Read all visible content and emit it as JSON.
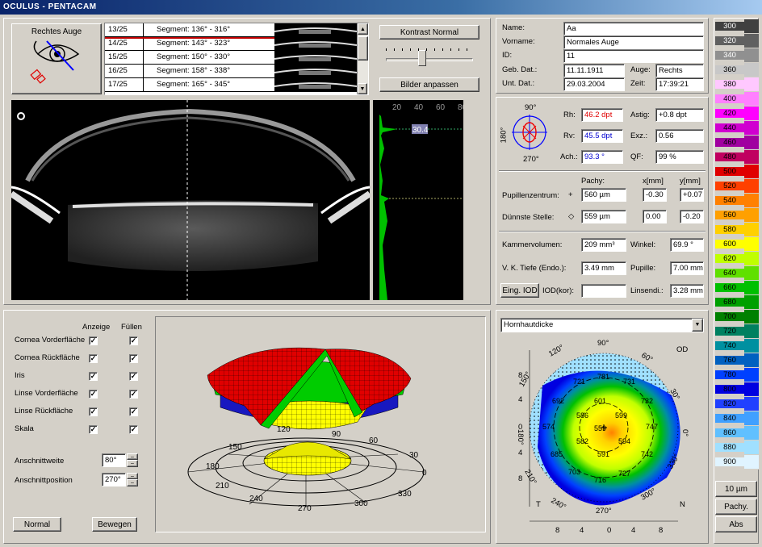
{
  "window_title": "OCULUS - PENTACAM",
  "eye_button": {
    "label": "Rechtes Auge"
  },
  "segments": [
    {
      "index": "13/25",
      "label": "Segment: 136° - 316°"
    },
    {
      "index": "14/25",
      "label": "Segment: 143° - 323°"
    },
    {
      "index": "15/25",
      "label": "Segment: 150° - 330°"
    },
    {
      "index": "16/25",
      "label": "Segment: 158° - 338°"
    },
    {
      "index": "17/25",
      "label": "Segment: 165° - 345°"
    }
  ],
  "buttons": {
    "contrast": "Kontrast Normal",
    "fit_images": "Bilder anpassen",
    "normal": "Normal",
    "move": "Bewegen",
    "eing_iod": "Eing. IOD"
  },
  "density_plot": {
    "ticks": [
      "20",
      "40",
      "60",
      "80"
    ],
    "marker_value": "30.4"
  },
  "patient": {
    "name_label": "Name:",
    "name": "Aa",
    "firstname_label": "Vorname:",
    "firstname": "Normales Auge",
    "id_label": "ID:",
    "id": "11",
    "dob_label": "Geb. Dat.:",
    "dob": "11.11.1911",
    "eye_label": "Auge:",
    "eye": "Rechts",
    "exam_label": "Unt. Dat.:",
    "exam": "29.03.2004",
    "time_label": "Zeit:",
    "time": "17:39:21"
  },
  "kerato": {
    "rh_label": "Rh:",
    "rh": "46.2 dpt",
    "astig_label": "Astig:",
    "astig": "+0.8 dpt",
    "rv_label": "Rv:",
    "rv": "45.5 dpt",
    "exz_label": "Exz.:",
    "exz": "0.56",
    "ach_label": "Ach.:",
    "ach": "93.3 °",
    "qf_label": "QF:",
    "qf": "99 %",
    "deg90": "90°",
    "deg180": "180°",
    "deg270": "270°"
  },
  "pachy": {
    "col_pachy": "Pachy:",
    "col_x": "x[mm]",
    "col_y": "y[mm]",
    "pupil_label": "Pupillenzentrum:",
    "pupil_sym": "+",
    "pupil_pachy": "560 µm",
    "pupil_x": "-0.30",
    "pupil_y": "+0.07",
    "thin_label": "Dünnste Stelle:",
    "thin_sym": "◇",
    "thin_pachy": "559 µm",
    "thin_x": "0.00",
    "thin_y": "-0.20"
  },
  "chamber": {
    "vol_label": "Kammervolumen:",
    "vol": "209 mm³",
    "angle_label": "Winkel:",
    "angle": "69.9 °",
    "depth_label": "V. K. Tiefe (Endo.):",
    "depth": "3.49 mm",
    "pupil_label": "Pupille:",
    "pupil": "7.00 mm",
    "iod_label": "IOD(kor):",
    "iod": "",
    "lens_label": "Linsendi.:",
    "lens": "3.28 mm"
  },
  "display": {
    "col_show": "Anzeige",
    "col_fill": "Füllen",
    "rows": [
      {
        "label": "Cornea Vorderfläche",
        "show": "✓",
        "fill": "✓"
      },
      {
        "label": "Cornea Rückfläche",
        "show": "✓",
        "fill": "✓"
      },
      {
        "label": "Iris",
        "show": "✓",
        "fill": "✓"
      },
      {
        "label": "Linse Vorderfläche",
        "show": "✓",
        "fill": "✓"
      },
      {
        "label": "Linse Rückfläche",
        "show": "✓",
        "fill": "✓"
      },
      {
        "label": "Skala",
        "show": "✓",
        "fill": "✓"
      }
    ],
    "width_label": "Anschnittweite",
    "width": "80°",
    "position_label": "Anschnittposition",
    "position": "270°"
  },
  "plot3d": {
    "angles": [
      "150",
      "120",
      "90",
      "60",
      "30",
      "0",
      "180",
      "210",
      "240",
      "270",
      "300",
      "330"
    ]
  },
  "map": {
    "select": "Hornhautdicke",
    "od": "OD",
    "t": "T",
    "n": "N",
    "angle_labels": [
      "90°",
      "60°",
      "30°",
      "0°",
      "330°",
      "300°",
      "270°",
      "240°",
      "210°",
      "180°",
      "150°",
      "120°"
    ],
    "y_ticks": [
      "8",
      "4",
      "0",
      "4",
      "8"
    ],
    "x_ticks": [
      "8",
      "4",
      "0",
      "4",
      "8"
    ],
    "values": [
      {
        "t": "781"
      },
      {
        "t": "721"
      },
      {
        "t": "731"
      },
      {
        "t": "692"
      },
      {
        "t": "601"
      },
      {
        "t": "732"
      },
      {
        "t": "586"
      },
      {
        "t": "599"
      },
      {
        "t": "574"
      },
      {
        "t": "559"
      },
      {
        "t": "747"
      },
      {
        "t": "582"
      },
      {
        "t": "594"
      },
      {
        "t": "685"
      },
      {
        "t": "591"
      },
      {
        "t": "742"
      },
      {
        "t": "703"
      },
      {
        "t": "716"
      },
      {
        "t": "727"
      }
    ]
  },
  "scale": {
    "entries": [
      {
        "v": "300",
        "c": "#404040"
      },
      {
        "v": "320",
        "c": "#606060"
      },
      {
        "v": "340",
        "c": "#909090"
      },
      {
        "v": "360",
        "c": "#c8c8c8"
      },
      {
        "v": "380",
        "c": "#ffc8ff"
      },
      {
        "v": "400",
        "c": "#ff80ff"
      },
      {
        "v": "420",
        "c": "#ff00ff"
      },
      {
        "v": "440",
        "c": "#d000d0"
      },
      {
        "v": "460",
        "c": "#a000a0"
      },
      {
        "v": "480",
        "c": "#c00060"
      },
      {
        "v": "500",
        "c": "#e00000"
      },
      {
        "v": "520",
        "c": "#ff4000"
      },
      {
        "v": "540",
        "c": "#ff8000"
      },
      {
        "v": "560",
        "c": "#ffa000"
      },
      {
        "v": "580",
        "c": "#ffd000"
      },
      {
        "v": "600",
        "c": "#ffff00"
      },
      {
        "v": "620",
        "c": "#c0ff00"
      },
      {
        "v": "640",
        "c": "#60e000"
      },
      {
        "v": "660",
        "c": "#00c000"
      },
      {
        "v": "680",
        "c": "#00a000"
      },
      {
        "v": "700",
        "c": "#008000"
      },
      {
        "v": "720",
        "c": "#008060"
      },
      {
        "v": "740",
        "c": "#0090a0"
      },
      {
        "v": "760",
        "c": "#0060c0"
      },
      {
        "v": "780",
        "c": "#0040ff"
      },
      {
        "v": "800",
        "c": "#0000e0"
      },
      {
        "v": "820",
        "c": "#2040ff"
      },
      {
        "v": "840",
        "c": "#40a0ff"
      },
      {
        "v": "860",
        "c": "#60c0ff"
      },
      {
        "v": "880",
        "c": "#a0e0ff"
      },
      {
        "v": "900",
        "c": "#e0f4ff"
      }
    ],
    "unit": "10 µm",
    "mode1": "Pachy.",
    "mode2": "Abs"
  }
}
